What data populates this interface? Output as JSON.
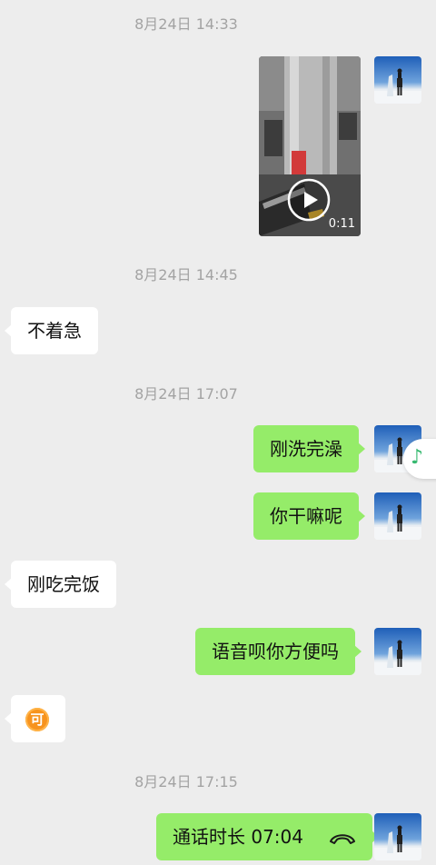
{
  "messages": {
    "ts1": "8月24日 14:33",
    "video_duration": "0:11",
    "ts2": "8月24日 14:45",
    "msg1": "不着急",
    "ts3": "8月24日 17:07",
    "msg2": "刚洗完澡",
    "msg3": "你干嘛呢",
    "msg4": "刚吃完饭",
    "msg5": "语音呗你方便吗",
    "msg6_emoji": "可",
    "ts4": "8月24日 17:15",
    "msg7_call": "通话时长 07:04"
  },
  "floating_widget": {
    "icon": "music-note-icon",
    "glyph": "♪"
  },
  "colors": {
    "background": "#ededed",
    "outgoing_bubble": "#95ec69",
    "incoming_bubble": "#ffffff",
    "timestamp": "#a3a3a3"
  }
}
